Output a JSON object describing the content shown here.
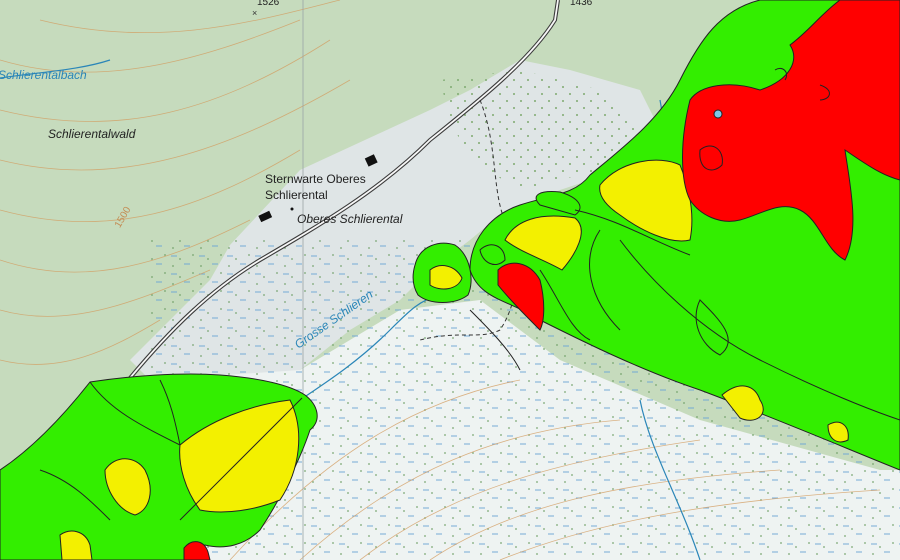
{
  "map": {
    "labels": {
      "spot_1526": "1526",
      "spot_1436": "1436",
      "schlierentalbach": "Schlierentalbach",
      "schlierentalwald": "Schlierentalwald",
      "sternwarte_line1": "Sternwarte Oberes",
      "sternwarte_line2": "Schlierental",
      "oberes_schlierental": "Oberes Schlierental",
      "contour_1500": "1500",
      "grosse_schlieren": "Grosse Schlieren"
    },
    "overlay_legend_colors": {
      "green": "#33ee00",
      "yellow": "#f3f000",
      "red": "#ff0000"
    },
    "base_colors": {
      "forest": "#c9dcbf",
      "open_land": "#eef2f1",
      "wetland_marks": "#4a8cc8",
      "contour": "#d39c5f",
      "road": "#3b3b3b",
      "stream": "#2a86b8"
    }
  }
}
